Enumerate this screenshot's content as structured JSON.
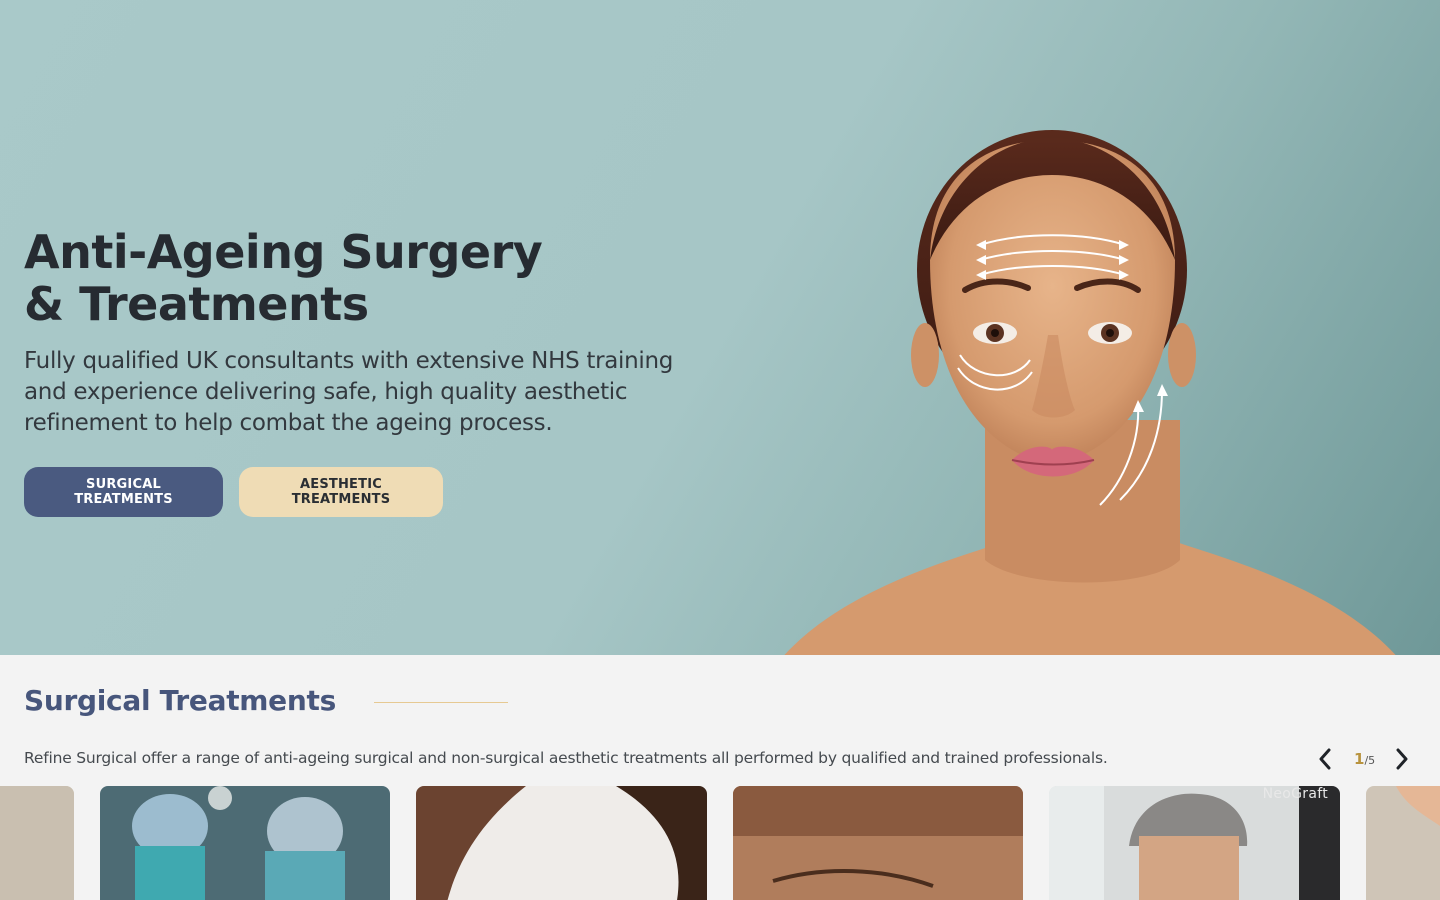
{
  "hero": {
    "title": "Anti-Ageing Surgery & Treatments",
    "subtitle": "Fully qualified UK consultants with extensive NHS training and experience delivering safe, high quality aesthetic refinement to help combat the ageing process.",
    "buttons": {
      "surgical_label": "SURGICAL TREATMENTS",
      "aesthetic_label": "AESTHETIC TREATMENTS"
    },
    "image": "woman-face-lift-arrows-illustration"
  },
  "section": {
    "title": "Surgical Treatments",
    "description": "Refine Surgical offer a range of anti-ageing surgical and non-surgical aesthetic treatments all performed by qualified and trained professionals.",
    "pager": {
      "current": "1",
      "total": "/5",
      "prev_icon": "chevron-left-icon",
      "next_icon": "chevron-right-icon"
    }
  },
  "cards": [
    {
      "image": "sand-skin-texture"
    },
    {
      "image": "surgeons-operating-theatre"
    },
    {
      "image": "woman-skin-closeup"
    },
    {
      "image": "man-eye-closeup"
    },
    {
      "image": "man-hair-transplant",
      "label": "NeoGraft"
    },
    {
      "image": "hand-sand-texture"
    }
  ],
  "colors": {
    "hero_bg": "#a6c6c6",
    "primary_button": "#4a5a80",
    "secondary_button": "#efdcb5",
    "section_title": "#47567c",
    "accent_gold": "#b8933e"
  }
}
